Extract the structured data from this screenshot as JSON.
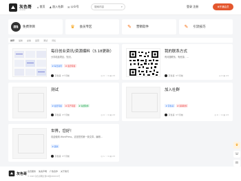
{
  "header": {
    "logo_text": "灰色哥",
    "logo_sub": "HUISEGE",
    "nav": [
      {
        "label": "首页",
        "icon": "home-icon",
        "glyph": "⌂"
      },
      {
        "label": "加入社群",
        "icon": "users-icon",
        "glyph": "♟"
      },
      {
        "label": "公众号",
        "icon": "wechat-icon",
        "glyph": "✉"
      }
    ],
    "search_placeholder": "搜索内容",
    "login_label": "登录 注册",
    "vip_label": "♛开通会员"
  },
  "categories": [
    {
      "label": "免费项目",
      "icon": "m-logo-icon",
      "glyph": "m",
      "color": "#333333"
    },
    {
      "label": "会员专区",
      "icon": "crown-icon",
      "glyph": "♛",
      "color": "#f59e0b"
    },
    {
      "label": "营销软件",
      "icon": "pencil-icon",
      "glyph": "✎",
      "color": "#f97316"
    },
    {
      "label": "引流技巧",
      "icon": "pencil-icon",
      "glyph": "✎",
      "color": "#f97316"
    }
  ],
  "breadcrumb": [
    "推荐",
    "最新",
    "虚拟",
    "运营",
    "测试",
    "评论"
  ],
  "posts": [
    {
      "title": "每日创业资讯/资源爆料（3.18更新）",
      "desc": "分享精选项目，知识。",
      "tags": [
        {
          "label": "# 每日资讯",
          "color": "blue"
        },
        {
          "label": "# 会员专属",
          "color": "red"
        }
      ],
      "author": "灰色哥",
      "time": "3个月前",
      "meta": "◎ 0  ♡ 0  ▤ 23"
    },
    {
      "title": "我的联系方式",
      "desc": "有问题联系，有资源，...",
      "tags": [],
      "author": "灰色哥",
      "time": "3个月前",
      "meta": "◎ 0  ▤ 23"
    },
    {
      "title": "测试",
      "desc": "",
      "tags": [
        {
          "label": "# 会员专属",
          "color": "blue"
        },
        {
          "label": "# 灰产项目",
          "color": "red"
        },
        {
          "label": "# 免费软件",
          "color": "green"
        }
      ],
      "author": "灰色哥",
      "time": "3个月前",
      "meta": "◎ 0  ♡ 0  ▤ 23"
    },
    {
      "title": "加入社群",
      "desc": "",
      "tags": [
        {
          "label": "# 灰色哥",
          "color": "blue"
        },
        {
          "label": "# 营销软件",
          "color": "red"
        }
      ],
      "author": "灰色哥",
      "time": "3个月前",
      "meta": "◎ 0  ♡ 0  ▤ 23"
    },
    {
      "title": "世界，您好！",
      "desc": "欢迎使用 WordPress。这是您的第一篇文章。编辑...",
      "tags": [
        {
          "label": "# 其他",
          "color": "blue"
        }
      ],
      "author": "灰色哥",
      "time": "3个月前",
      "meta": "◎ 1  ♡ 0  ▤ 23"
    }
  ],
  "floatbar": [
    {
      "icon": "crown-icon",
      "glyph": "♛"
    },
    {
      "icon": "chat-icon",
      "glyph": "☏"
    },
    {
      "icon": "wechat-icon",
      "glyph": "✉"
    },
    {
      "icon": "back-to-top-icon",
      "glyph": "↑"
    }
  ],
  "footer": {
    "logo_text": "灰色哥",
    "links": [
      "会员服务",
      "免责声明",
      "广告合作",
      "关于我们"
    ],
    "copyright": "© 2023 灰色哥网络 浙ICP备XXXXXX号"
  }
}
